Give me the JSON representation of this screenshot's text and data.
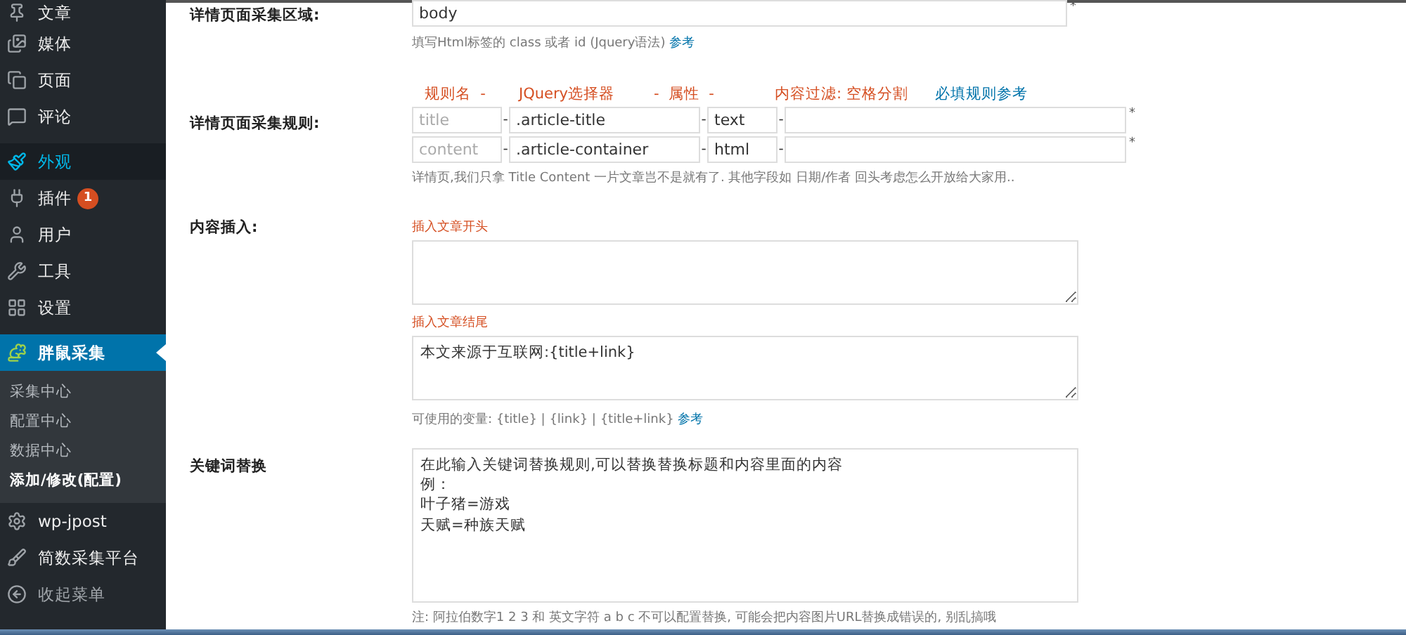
{
  "sidebar": {
    "groups": [
      {
        "items": [
          {
            "label": "文章",
            "selected": false,
            "hover": false
          },
          {
            "label": "媒体",
            "selected": false,
            "hover": false
          },
          {
            "label": "页面",
            "selected": false,
            "hover": false
          },
          {
            "label": "评论",
            "selected": false,
            "hover": false
          }
        ]
      },
      {
        "items": [
          {
            "label": "外观",
            "selected": false,
            "hover": true
          },
          {
            "label": "插件",
            "selected": false,
            "hover": false,
            "badge": "1"
          },
          {
            "label": "用户",
            "selected": false,
            "hover": false
          },
          {
            "label": "工具",
            "selected": false,
            "hover": false
          },
          {
            "label": "设置",
            "selected": false,
            "hover": false
          }
        ]
      },
      {
        "items": [
          {
            "label": "胖鼠采集",
            "selected": true,
            "hover": false,
            "children": [
              {
                "label": "采集中心",
                "selected": false
              },
              {
                "label": "配置中心",
                "selected": false
              },
              {
                "label": "数据中心",
                "selected": false
              },
              {
                "label": "添加/修改(配置)",
                "selected": true
              }
            ]
          },
          {
            "label": "wp-jpost",
            "selected": false,
            "hover": false
          },
          {
            "label": "简数采集平台",
            "selected": false,
            "hover": false
          },
          {
            "label": "收起菜单",
            "selected": false,
            "hover": false,
            "muted": true
          }
        ]
      }
    ]
  },
  "form": {
    "area": {
      "label": "详情页面采集区域:",
      "value": "body",
      "required": "*",
      "hint": "填写Html标签的 class 或者 id (Jquery语法)",
      "hint_link": "参考"
    },
    "rules": {
      "label": "详情页面采集规则:",
      "headers": [
        "规则名  -",
        "JQuery选择器",
        "-  属性  -",
        "内容过滤: 空格分割"
      ],
      "header_link": "必填规则参考",
      "rows": [
        {
          "name_placeholder": "title",
          "selector": ".article-title",
          "attribute": "text",
          "required": "*",
          "separators": [
            "-",
            "-",
            "-"
          ]
        },
        {
          "name_placeholder": "content",
          "selector": ".article-container",
          "attribute": "html",
          "required": "*",
          "separators": [
            "-",
            "-",
            "-"
          ]
        }
      ],
      "hint": "详情页,我们只拿 Title Content 一片文章岂不是就有了. 其他字段如 日期/作者 回头考虑怎么开放给大家用.."
    },
    "insert": {
      "label": "内容插入:",
      "head_label": "插入文章开头",
      "tail_label": "插入文章结尾",
      "tail_value": "本文来源于互联网:{title+link}",
      "hint": "可使用的变量: {title} | {link} | {title+link}",
      "hint_link": "参考"
    },
    "replace": {
      "label": "关键词替换",
      "lines": [
        "在此输入关键词替换规则,可以替换替换标题和内容里面的内容",
        "例：",
        "叶子猪=游戏",
        "天赋=种族天赋"
      ],
      "note": "注: 阿拉伯数字1 2 3 和 英文字符 a b c 不可以配置替换, 可能会把内容图片URL替换成错误的, 别乱搞哦"
    }
  }
}
